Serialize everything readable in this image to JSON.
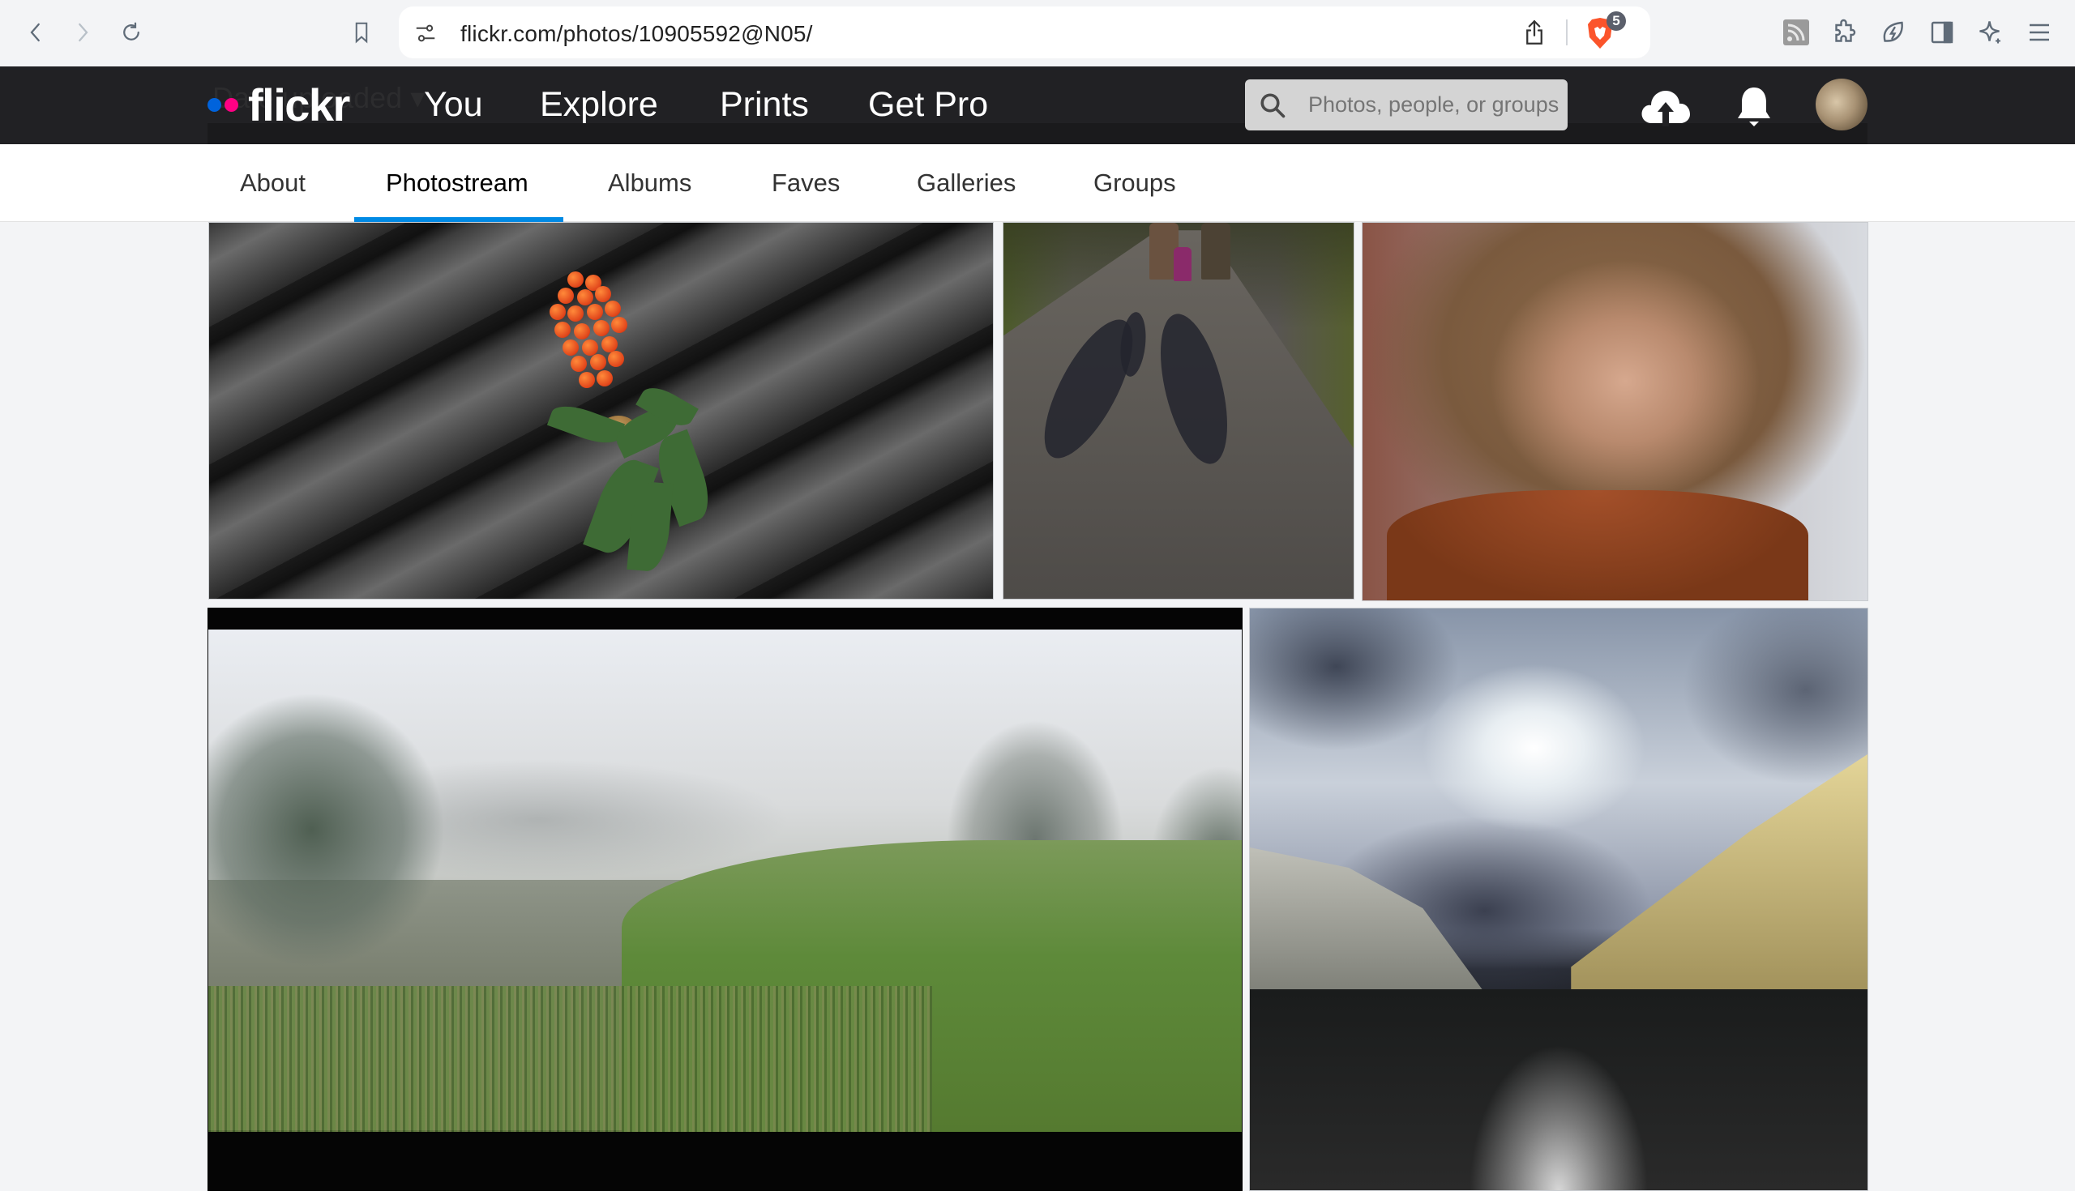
{
  "browser": {
    "url": "flickr.com/photos/10905592@N05/",
    "shields_count": "5",
    "icons": {
      "back": "chevron-left-icon",
      "forward": "chevron-right-icon",
      "reload": "reload-icon",
      "bookmark": "bookmark-icon",
      "site_settings": "tune-icon",
      "share": "share-icon",
      "shields": "brave-shields-icon",
      "rss": "rss-icon",
      "extensions": "puzzle-icon",
      "speedreader": "leaf-bolt-icon",
      "sidebar": "sidebar-icon",
      "leo": "sparkle-icon",
      "menu": "hamburger-icon"
    }
  },
  "header": {
    "logo": "flickr",
    "brand_colors": {
      "blue": "#0063dc",
      "pink": "#ff0084"
    },
    "nav": [
      {
        "label": "You"
      },
      {
        "label": "Explore"
      },
      {
        "label": "Prints"
      },
      {
        "label": "Get Pro"
      }
    ],
    "search": {
      "placeholder": "Photos, people, or groups",
      "value": ""
    },
    "ghost_sort_label": "Date uploaded ▾"
  },
  "subnav": {
    "tabs": [
      {
        "label": "About",
        "active": false
      },
      {
        "label": "Photostream",
        "active": true
      },
      {
        "label": "Albums",
        "active": false
      },
      {
        "label": "Faves",
        "active": false
      },
      {
        "label": "Galleries",
        "active": false
      },
      {
        "label": "Groups",
        "active": false
      }
    ],
    "accent": "#008ae4"
  },
  "photos": [
    {
      "subject": "Rowan berries with leaf on a weathered wooden bench"
    },
    {
      "subject": "Family walking on a park path with long shadows"
    },
    {
      "subject": "Portrait of a woman with wavy hair in a brown leather jacket"
    },
    {
      "subject": "Misty lake with reeds and green meadow"
    },
    {
      "subject": "City canal under dramatic clouds with boats and buildings"
    }
  ]
}
